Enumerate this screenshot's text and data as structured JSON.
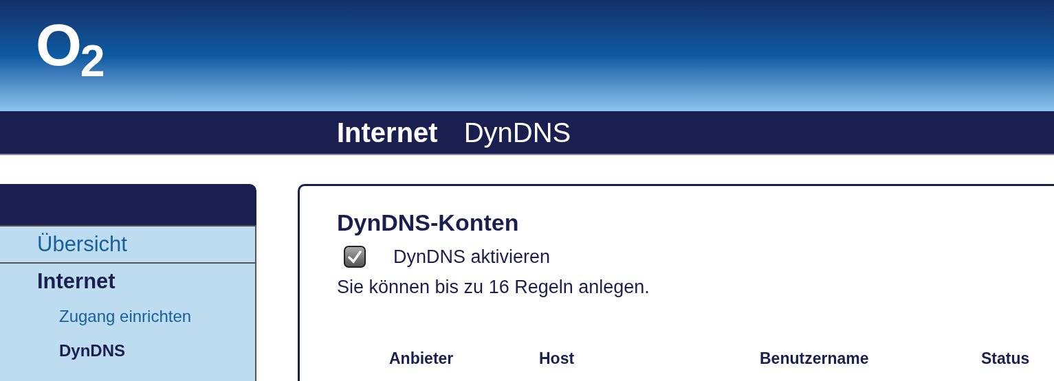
{
  "logo": {
    "text": "O$_{2}$"
  },
  "title_bar": {
    "section": "Internet",
    "page": "DynDNS"
  },
  "sidebar": {
    "items": [
      {
        "label": "Übersicht",
        "selected": false
      },
      {
        "label": "Internet",
        "selected": true,
        "children": [
          {
            "label": "Zugang einrichten",
            "selected": false
          },
          {
            "label": "DynDNS",
            "selected": true
          }
        ]
      }
    ]
  },
  "panel": {
    "heading": "DynDNS-Konten",
    "enable": {
      "label": "DynDNS aktivieren",
      "checked": true
    },
    "info": "Sie können bis zu 16 Regeln anlegen.",
    "table": {
      "columns": [
        "Anbieter",
        "Host",
        "Benutzername",
        "Status"
      ]
    }
  }
}
